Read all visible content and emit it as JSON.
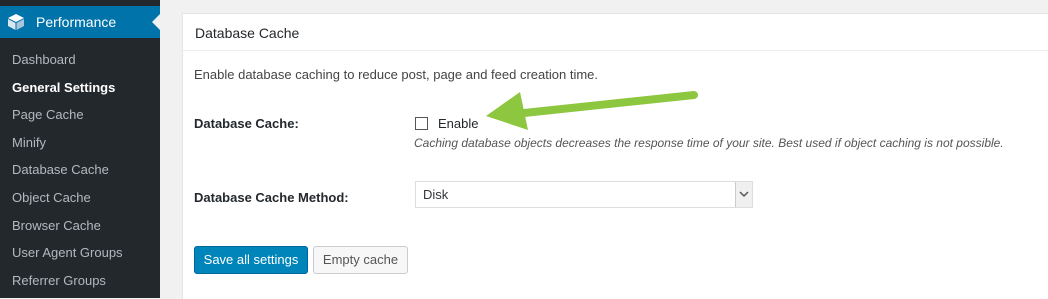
{
  "sidebar": {
    "header_title": "Performance",
    "items": [
      {
        "label": "Dashboard"
      },
      {
        "label": "General Settings"
      },
      {
        "label": "Page Cache"
      },
      {
        "label": "Minify"
      },
      {
        "label": "Database Cache"
      },
      {
        "label": "Object Cache"
      },
      {
        "label": "Browser Cache"
      },
      {
        "label": "User Agent Groups"
      },
      {
        "label": "Referrer Groups"
      }
    ],
    "current_item": "General Settings"
  },
  "panel": {
    "title": "Database Cache",
    "intro": "Enable database caching to reduce post, page and feed creation time.",
    "database_cache_label": "Database Cache:",
    "enable_label": "Enable",
    "enable_checked": false,
    "description": "Caching database objects decreases the response time of your site. Best used if object caching is not possible.",
    "method_label": "Database Cache Method:",
    "method_value": "Disk",
    "save_button": "Save all settings",
    "empty_button": "Empty cache"
  },
  "colors": {
    "sidebar_bg": "#23282d",
    "sidebar_active": "#0073aa",
    "primary_button": "#0085ba",
    "annotation_arrow": "#8dc63f"
  }
}
